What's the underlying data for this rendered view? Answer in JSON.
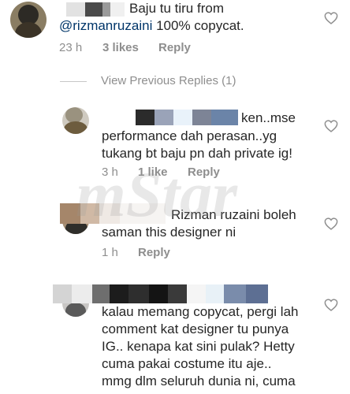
{
  "comments": [
    {
      "id": "c1",
      "text_line1": "Baju tu tiru from",
      "mention": "@rizmanruzaini",
      "text_line2_rest": " 100% copycat.",
      "time": "23 h",
      "likes": "3 likes",
      "reply": "Reply"
    },
    {
      "id": "c2",
      "text_line1": "ken..mse",
      "text_line2": "performance dah perasan..yg",
      "text_line3": "tukang bt baju pn dah private ig!",
      "time": "3 h",
      "likes": "1 like",
      "reply": "Reply"
    },
    {
      "id": "c3",
      "text_line1": "Rizman ruzaini boleh",
      "text_line2": "saman this designer ni",
      "time": "1 h",
      "reply": "Reply"
    },
    {
      "id": "c4",
      "text_line1": "kalau memang copycat, pergi lah",
      "text_line2": "comment kat designer tu punya",
      "text_line3": "IG.. kenapa kat sini pulak? Hetty",
      "text_line4": "cuma pakai costume itu aje..",
      "text_line5": "mmg dlm seluruh dunia ni, cuma"
    }
  ],
  "view_previous_replies": "View Previous Replies (1)",
  "watermark_text": "mStar",
  "icons": {
    "like": "heart-outline-icon"
  }
}
